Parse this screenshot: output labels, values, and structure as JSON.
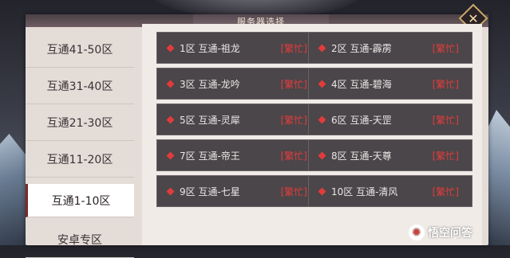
{
  "dialog": {
    "title": "服务器选择",
    "close_symbol": "✕"
  },
  "sidebar": {
    "items": [
      {
        "label": "互通41-50区",
        "active": false
      },
      {
        "label": "互通31-40区",
        "active": false
      },
      {
        "label": "互通21-30区",
        "active": false
      },
      {
        "label": "互通11-20区",
        "active": false
      },
      {
        "label": "互通1-10区",
        "active": true
      },
      {
        "label": "安卓专区",
        "active": false
      }
    ]
  },
  "servers": [
    {
      "name": "1区 互通-祖龙",
      "status": "[繁忙]"
    },
    {
      "name": "2区 互通-霹雳",
      "status": "[繁忙]"
    },
    {
      "name": "3区 互通-龙吟",
      "status": "[繁忙]"
    },
    {
      "name": "4区 互通-碧海",
      "status": "[繁忙]"
    },
    {
      "name": "5区 互通-灵犀",
      "status": "[繁忙]"
    },
    {
      "name": "6区 互通-天罡",
      "status": "[繁忙]"
    },
    {
      "name": "7区 互通-帝王",
      "status": "[繁忙]"
    },
    {
      "name": "8区 互通-天尊",
      "status": "[繁忙]"
    },
    {
      "name": "9区 互通-七星",
      "status": "[繁忙]"
    },
    {
      "name": "10区 互通-清风",
      "status": "[繁忙]"
    }
  ],
  "watermark": {
    "text": "悟空问答",
    "logo_glyph": "✺"
  },
  "colors": {
    "busy": "#e63c3c",
    "cell_bg": "#4a4649",
    "panel_bg": "#e4dcd6"
  }
}
